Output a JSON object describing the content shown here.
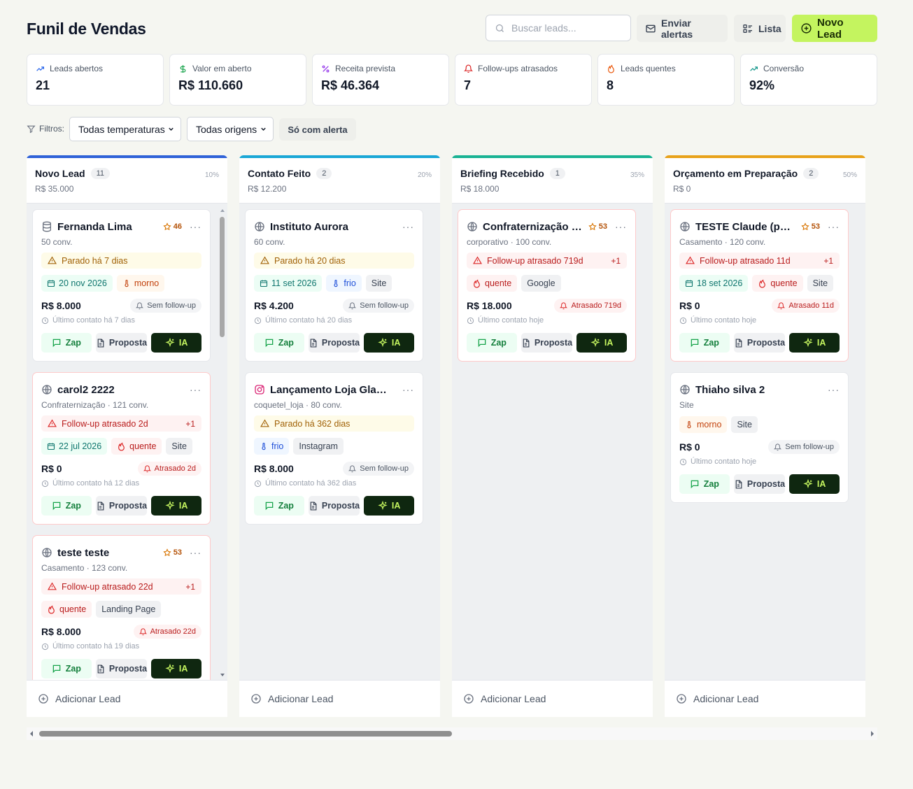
{
  "header": {
    "title": "Funil de Vendas",
    "search_placeholder": "Buscar leads...",
    "alerts_label": "Enviar alertas",
    "list_label": "Lista",
    "new_lead_label": "Novo Lead"
  },
  "stats": [
    {
      "label": "Leads abertos",
      "value": "21",
      "icon": "trending-up-icon",
      "color": "#2563eb"
    },
    {
      "label": "Valor em aberto",
      "value": "R$ 110.660",
      "icon": "dollar-icon",
      "color": "#16a34a"
    },
    {
      "label": "Receita prevista",
      "value": "R$ 46.364",
      "icon": "percent-icon",
      "color": "#9333ea"
    },
    {
      "label": "Follow-ups atrasados",
      "value": "7",
      "icon": "bell-icon",
      "color": "#dc2626"
    },
    {
      "label": "Leads quentes",
      "value": "8",
      "icon": "flame-icon",
      "color": "#ea580c"
    },
    {
      "label": "Conversão",
      "value": "92%",
      "icon": "trending-up-icon",
      "color": "#0d9488"
    }
  ],
  "filters": {
    "label": "Filtros:",
    "temperature": "Todas temperaturas",
    "origin": "Todas origens",
    "only_alert": "Só com alerta"
  },
  "columns": [
    {
      "title": "Novo Lead",
      "count": "11",
      "pct": "10%",
      "total": "R$ 35.000",
      "color": "#2f62d8",
      "add_label": "Adicionar Lead",
      "cards": [
        {
          "name": "Fernanda Lima",
          "icon": "database-icon",
          "score": "46",
          "sub": "50 conv.",
          "warn": {
            "type": "yellow",
            "text": "Parado há 7 dias",
            "extra": ""
          },
          "chips": [
            {
              "type": "date",
              "text": "20 nov 2026"
            },
            {
              "type": "morno",
              "text": "morno"
            }
          ],
          "value": "R$ 8.000",
          "fu": {
            "type": "none",
            "text": "Sem follow-up"
          },
          "last": "Último contato há 7 dias",
          "alert": false
        },
        {
          "name": "carol2 2222",
          "icon": "globe-icon",
          "score": "",
          "sub": "Confraternização · 121 conv.",
          "warn": {
            "type": "red",
            "text": "Follow-up atrasado 2d",
            "extra": "+1"
          },
          "chips": [
            {
              "type": "date",
              "text": "22 jul 2026"
            },
            {
              "type": "quente",
              "text": "quente"
            },
            {
              "type": "src",
              "text": "Site"
            }
          ],
          "value": "R$ 0",
          "fu": {
            "type": "late",
            "text": "Atrasado 2d"
          },
          "last": "Último contato há 12 dias",
          "alert": true
        },
        {
          "name": "teste teste",
          "icon": "globe-icon",
          "score": "53",
          "sub": "Casamento · 123 conv.",
          "warn": {
            "type": "red",
            "text": "Follow-up atrasado 22d",
            "extra": "+1"
          },
          "chips": [
            {
              "type": "quente",
              "text": "quente"
            },
            {
              "type": "src",
              "text": "Landing Page"
            }
          ],
          "value": "R$ 8.000",
          "fu": {
            "type": "late",
            "text": "Atrasado 22d"
          },
          "last": "Último contato há 19 dias",
          "alert": true
        }
      ]
    },
    {
      "title": "Contato Feito",
      "count": "2",
      "pct": "20%",
      "total": "R$ 12.200",
      "color": "#1aa7d6",
      "add_label": "Adicionar Lead",
      "cards": [
        {
          "name": "Instituto Aurora",
          "icon": "globe-icon",
          "score": "",
          "sub": "60 conv.",
          "warn": {
            "type": "yellow",
            "text": "Parado há 20 dias",
            "extra": ""
          },
          "chips": [
            {
              "type": "date",
              "text": "11 set 2026"
            },
            {
              "type": "frio",
              "text": "frio"
            },
            {
              "type": "src",
              "text": "Site"
            }
          ],
          "value": "R$ 4.200",
          "fu": {
            "type": "none",
            "text": "Sem follow-up"
          },
          "last": "Último contato há 20 dias",
          "alert": false
        },
        {
          "name": "Lançamento Loja Glamour",
          "icon": "instagram-icon",
          "score": "",
          "sub": "coquetel_loja · 80 conv.",
          "warn": {
            "type": "yellow",
            "text": "Parado há 362 dias",
            "extra": ""
          },
          "chips": [
            {
              "type": "frio",
              "text": "frio"
            },
            {
              "type": "src",
              "text": "Instagram"
            }
          ],
          "value": "R$ 8.000",
          "fu": {
            "type": "none",
            "text": "Sem follow-up"
          },
          "last": "Último contato há 362 dias",
          "alert": false
        }
      ]
    },
    {
      "title": "Briefing Recebido",
      "count": "1",
      "pct": "35%",
      "total": "R$ 18.000",
      "color": "#19b394",
      "add_label": "Adicionar Lead",
      "cards": [
        {
          "name": "Confraternização Tech",
          "icon": "globe-icon",
          "score": "53",
          "sub": "corporativo · 100 conv.",
          "warn": {
            "type": "red",
            "text": "Follow-up atrasado 719d",
            "extra": "+1"
          },
          "chips": [
            {
              "type": "quente",
              "text": "quente"
            },
            {
              "type": "src",
              "text": "Google"
            }
          ],
          "value": "R$ 18.000",
          "fu": {
            "type": "late",
            "text": "Atrasado 719d"
          },
          "last": "Último contato hoje",
          "alert": true
        }
      ]
    },
    {
      "title": "Orçamento em Preparação",
      "count": "2",
      "pct": "50%",
      "total": "R$ 0",
      "color": "#e8a21a",
      "add_label": "Adicionar Lead",
      "cards": [
        {
          "name": "TESTE Claude (pode excluir)",
          "icon": "globe-icon",
          "score": "53",
          "sub": "Casamento · 120 conv.",
          "warn": {
            "type": "red",
            "text": "Follow-up atrasado 11d",
            "extra": "+1"
          },
          "chips": [
            {
              "type": "date",
              "text": "18 set 2026"
            },
            {
              "type": "quente",
              "text": "quente"
            },
            {
              "type": "src",
              "text": "Site"
            }
          ],
          "value": "R$ 0",
          "fu": {
            "type": "late",
            "text": "Atrasado 11d"
          },
          "last": "Último contato hoje",
          "alert": true
        },
        {
          "name": "Thiaho silva 2",
          "icon": "globe-icon",
          "score": "",
          "sub": "Site",
          "warn": null,
          "chips": [
            {
              "type": "morno",
              "text": "morno"
            },
            {
              "type": "src",
              "text": "Site"
            }
          ],
          "value": "R$ 0",
          "fu": {
            "type": "none",
            "text": "Sem follow-up"
          },
          "last": "Último contato hoje",
          "alert": false
        }
      ]
    }
  ],
  "card_actions": {
    "zap": "Zap",
    "proposal": "Proposta",
    "ai": "IA"
  }
}
